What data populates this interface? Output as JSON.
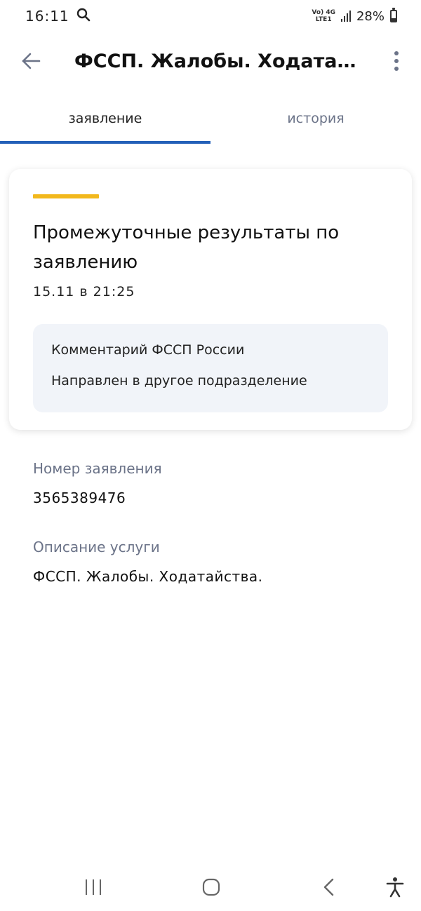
{
  "status": {
    "time": "16:11",
    "net_top": "Vo) 4G",
    "net_bottom": "LTE1",
    "battery_pct": "28%",
    "battery_level": 0.28
  },
  "app_bar": {
    "title": "ФССП. Жалобы. Ходатай..."
  },
  "tabs": [
    {
      "label": "заявление",
      "active": true
    },
    {
      "label": "история",
      "active": false
    }
  ],
  "card": {
    "title": "Промежуточные результаты по заявлению",
    "date": "15.11 в 21:25",
    "comment_label": "Комментарий ФССП России",
    "comment_value": "Направлен в другое подразделение"
  },
  "fields": [
    {
      "label": "Номер заявления",
      "value": "3565389476"
    },
    {
      "label": "Описание услуги",
      "value": "ФССП. Жалобы. Ходатайства."
    }
  ],
  "colors": {
    "accent": "#f2b81c",
    "tab_indicator": "#2460b8",
    "muted": "#6b7388",
    "comment_bg": "#f1f4f9"
  }
}
